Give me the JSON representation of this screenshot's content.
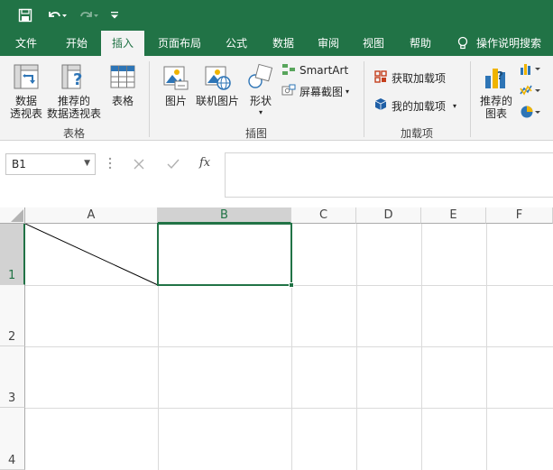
{
  "titlebar": {
    "save_icon": "save-icon",
    "undo_icon": "undo-icon",
    "redo_icon": "redo-icon",
    "customize_icon": "customize-qat-icon"
  },
  "tabs": [
    {
      "label": "文件"
    },
    {
      "label": "开始"
    },
    {
      "label": "插入",
      "active": true
    },
    {
      "label": "页面布局"
    },
    {
      "label": "公式"
    },
    {
      "label": "数据"
    },
    {
      "label": "审阅"
    },
    {
      "label": "视图"
    },
    {
      "label": "帮助"
    }
  ],
  "tellme": {
    "label": "操作说明搜索"
  },
  "ribbon": {
    "tables": {
      "pivot_line1": "数据",
      "pivot_line2": "透视表",
      "recommended_line1": "推荐的",
      "recommended_line2": "数据透视表",
      "table": "表格",
      "group": "表格"
    },
    "illustrations": {
      "pictures": "图片",
      "online_pictures": "联机图片",
      "shapes": "形状",
      "smartart": "SmartArt",
      "screenshot": "屏幕截图",
      "group": "插图"
    },
    "addins": {
      "get": "获取加载项",
      "my": "我的加载项",
      "group": "加载项"
    },
    "charts": {
      "recommended_line1": "推荐的",
      "recommended_line2": "图表"
    }
  },
  "formula": {
    "namebox": "B1",
    "cancel_icon": "cancel-icon",
    "enter_icon": "enter-icon",
    "fx": "fx",
    "value": ""
  },
  "grid": {
    "columns": [
      "A",
      "B",
      "C",
      "D",
      "E",
      "F"
    ],
    "rows": [
      "1",
      "2",
      "3",
      "4"
    ],
    "selected_cell": "B1",
    "colors": {
      "accent": "#217346",
      "header_bg": "#f8f8f8",
      "gridline": "#dadada"
    }
  }
}
